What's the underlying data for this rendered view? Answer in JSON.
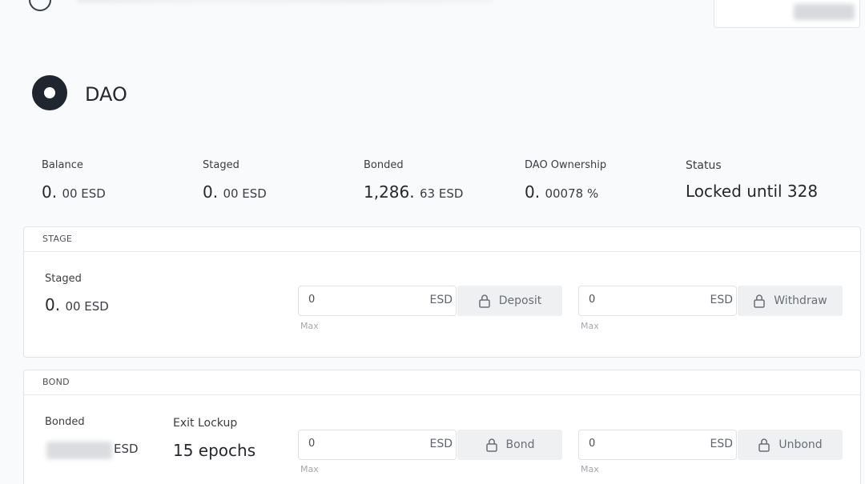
{
  "page": {
    "title": "DAO"
  },
  "stats": [
    {
      "label": "Balance",
      "int": "0.",
      "dec": "00 ESD"
    },
    {
      "label": "Staged",
      "int": "0.",
      "dec": "00 ESD"
    },
    {
      "label": "Bonded",
      "int": "1,286.",
      "dec": "63 ESD"
    },
    {
      "label": "DAO Ownership",
      "int": "0.",
      "dec": "00078 %"
    },
    {
      "label": "Status",
      "int": "Locked until 328",
      "dec": ""
    }
  ],
  "stage": {
    "header": "STAGE",
    "staged_label": "Staged",
    "staged_int": "0.",
    "staged_dec": "00 ESD",
    "deposit": {
      "value": "0",
      "unit": "ESD",
      "max": "Max",
      "button": "Deposit"
    },
    "withdraw": {
      "value": "0",
      "unit": "ESD",
      "max": "Max",
      "button": "Withdraw"
    }
  },
  "bond": {
    "header": "BOND",
    "bonded_label": "Bonded",
    "bonded_unit": "ESD",
    "exit_label": "Exit Lockup",
    "exit_value": "15 epochs",
    "bond": {
      "value": "0",
      "unit": "ESD",
      "max": "Max",
      "button": "Bond"
    },
    "unbond": {
      "value": "0",
      "unit": "ESD",
      "max": "Max",
      "button": "Unbond"
    }
  },
  "icons": {
    "lock": "lock-icon",
    "dao": "dao-logo-icon"
  },
  "colors": {
    "background": "#f9fafb",
    "panel": "#ffffff",
    "button": "#eef0f2",
    "text": "#25282c",
    "muted": "#a4a8ae"
  }
}
